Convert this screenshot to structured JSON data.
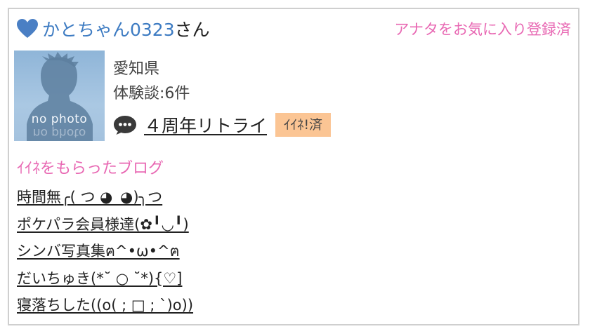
{
  "header": {
    "username": "かとちゃん0323",
    "honorific": "さん",
    "favorite_status": "アナタをお気に入り登録済"
  },
  "profile": {
    "avatar_caption": "no photo",
    "location": "愛知県",
    "experience_count": "体験談:6件",
    "latest_post_title": "４周年リトライ",
    "like_badge": "ｲｲﾈ!済"
  },
  "liked_blogs": {
    "title": "ｲｲﾈをもらったブログ",
    "items": [
      {
        "label": "時間無╭( つ ◕_◕)╮つ"
      },
      {
        "label": "ポケパラ会員様達(✿╹◡╹)"
      },
      {
        "label": "シンバ写真集ฅ^•ω•^ฅ"
      },
      {
        "label": "だいちゅき(*˘ ○ ˘*){♡]"
      },
      {
        "label": "寝落ちした((o( ; □ ; `)o))"
      }
    ]
  },
  "colors": {
    "username": "#3d7bc2",
    "accent_pink": "#e868b3",
    "badge_bg": "#fbc594",
    "border": "#cfcfcf",
    "heart": "#4a7fc4"
  },
  "icons": {
    "favorite": "heart-icon",
    "post": "speech-bubble-icon"
  }
}
